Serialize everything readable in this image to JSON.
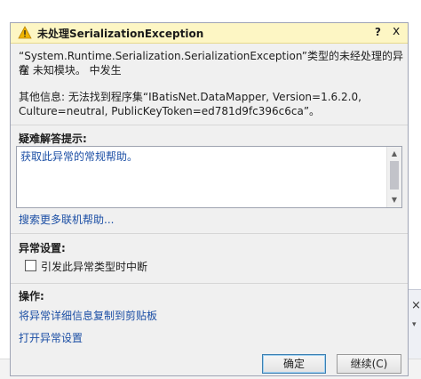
{
  "dialog": {
    "title": "未处理SerializationException",
    "help": "?",
    "close": "x",
    "message_line1": "“System.Runtime.Serialization.SerializationException”类型的未经处理的异常",
    "message_line2": "在 未知模块。 中发生",
    "info_line1": "其他信息: 无法找到程序集“IBatisNet.DataMapper, Version=1.6.2.0,",
    "info_line2": "Culture=neutral, PublicKeyToken=ed781d9fc396c6ca”。",
    "tips_heading": "疑难解答提示:",
    "tips": [
      "获取此异常的常规帮助。"
    ],
    "search_link": "搜索更多联机帮助...",
    "settings_heading": "异常设置:",
    "break_checkbox_label": "引发此异常类型时中断",
    "break_checked": false,
    "actions_heading": "操作:",
    "action_copy": "将异常详细信息复制到剪贴板",
    "action_open_settings": "打开异常设置",
    "ok_button": "确定",
    "continue_button": "继续(C)"
  },
  "background": {
    "close_glyph": "×",
    "dropdown_glyph": "▾"
  },
  "colors": {
    "title_bg": "#fdf6c4",
    "link": "#1c4fa5",
    "dialog_bg": "#f0f0f0",
    "warning": "#f0b400"
  }
}
